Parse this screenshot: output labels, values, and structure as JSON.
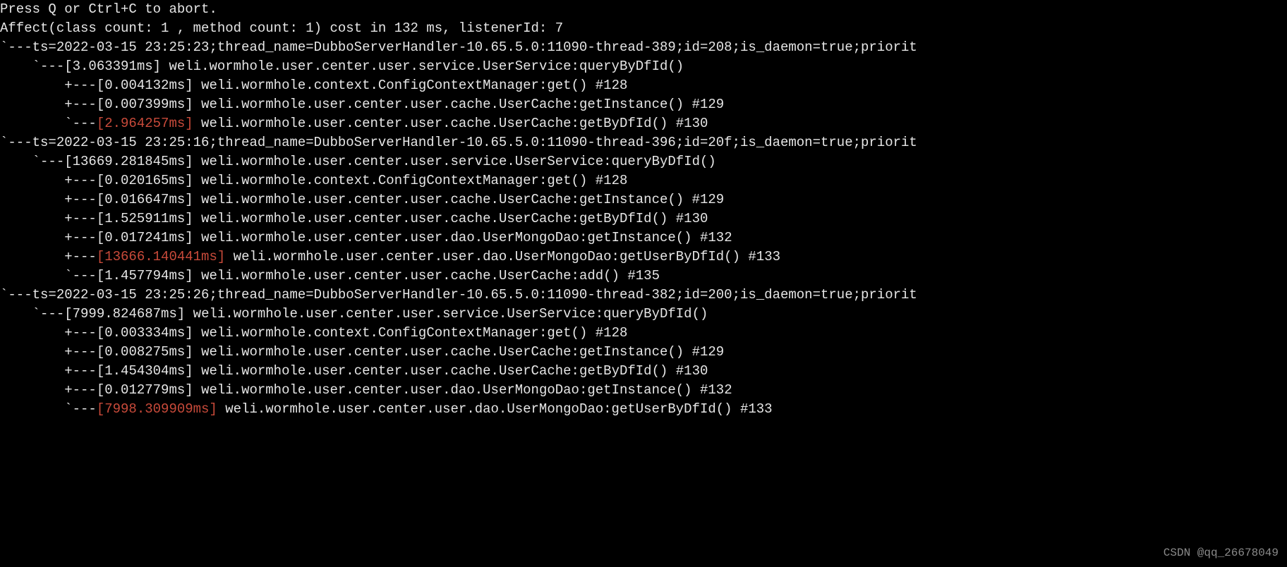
{
  "header_lines": [
    "Press Q or Ctrl+C to abort.",
    "Affect(class count: 1 , method count: 1) cost in 132 ms, listenerId: 7"
  ],
  "traces": [
    {
      "header": "`---ts=2022-03-15 23:25:23;thread_name=DubboServerHandler-10.65.5.0:11090-thread-389;id=208;is_daemon=true;priorit",
      "lines": [
        {
          "prefix": "    `---[",
          "time": "3.063391ms",
          "highlight": false,
          "suffix": "] weli.wormhole.user.center.user.service.UserService:queryByDfId()"
        },
        {
          "prefix": "        +---[",
          "time": "0.004132ms",
          "highlight": false,
          "suffix": "] weli.wormhole.context.ConfigContextManager:get() #128"
        },
        {
          "prefix": "        +---[",
          "time": "0.007399ms",
          "highlight": false,
          "suffix": "] weli.wormhole.user.center.user.cache.UserCache:getInstance() #129"
        },
        {
          "prefix": "        `---",
          "time": "[2.964257ms]",
          "highlight": true,
          "suffix": " weli.wormhole.user.center.user.cache.UserCache:getByDfId() #130"
        }
      ]
    },
    {
      "header": "`---ts=2022-03-15 23:25:16;thread_name=DubboServerHandler-10.65.5.0:11090-thread-396;id=20f;is_daemon=true;priorit",
      "lines": [
        {
          "prefix": "    `---[",
          "time": "13669.281845ms",
          "highlight": false,
          "suffix": "] weli.wormhole.user.center.user.service.UserService:queryByDfId()"
        },
        {
          "prefix": "        +---[",
          "time": "0.020165ms",
          "highlight": false,
          "suffix": "] weli.wormhole.context.ConfigContextManager:get() #128"
        },
        {
          "prefix": "        +---[",
          "time": "0.016647ms",
          "highlight": false,
          "suffix": "] weli.wormhole.user.center.user.cache.UserCache:getInstance() #129"
        },
        {
          "prefix": "        +---[",
          "time": "1.525911ms",
          "highlight": false,
          "suffix": "] weli.wormhole.user.center.user.cache.UserCache:getByDfId() #130"
        },
        {
          "prefix": "        +---[",
          "time": "0.017241ms",
          "highlight": false,
          "suffix": "] weli.wormhole.user.center.user.dao.UserMongoDao:getInstance() #132"
        },
        {
          "prefix": "        +---",
          "time": "[13666.140441ms]",
          "highlight": true,
          "suffix": " weli.wormhole.user.center.user.dao.UserMongoDao:getUserByDfId() #133"
        },
        {
          "prefix": "        `---[",
          "time": "1.457794ms",
          "highlight": false,
          "suffix": "] weli.wormhole.user.center.user.cache.UserCache:add() #135"
        }
      ]
    },
    {
      "header": "`---ts=2022-03-15 23:25:26;thread_name=DubboServerHandler-10.65.5.0:11090-thread-382;id=200;is_daemon=true;priorit",
      "lines": [
        {
          "prefix": "    `---[",
          "time": "7999.824687ms",
          "highlight": false,
          "suffix": "] weli.wormhole.user.center.user.service.UserService:queryByDfId()"
        },
        {
          "prefix": "        +---[",
          "time": "0.003334ms",
          "highlight": false,
          "suffix": "] weli.wormhole.context.ConfigContextManager:get() #128"
        },
        {
          "prefix": "        +---[",
          "time": "0.008275ms",
          "highlight": false,
          "suffix": "] weli.wormhole.user.center.user.cache.UserCache:getInstance() #129"
        },
        {
          "prefix": "        +---[",
          "time": "1.454304ms",
          "highlight": false,
          "suffix": "] weli.wormhole.user.center.user.cache.UserCache:getByDfId() #130"
        },
        {
          "prefix": "        +---[",
          "time": "0.012779ms",
          "highlight": false,
          "suffix": "] weli.wormhole.user.center.user.dao.UserMongoDao:getInstance() #132"
        },
        {
          "prefix": "        `---",
          "time": "[7998.309909ms]",
          "highlight": true,
          "suffix": " weli.wormhole.user.center.user.dao.UserMongoDao:getUserByDfId() #133"
        }
      ]
    }
  ],
  "watermark": "CSDN @qq_26678049"
}
